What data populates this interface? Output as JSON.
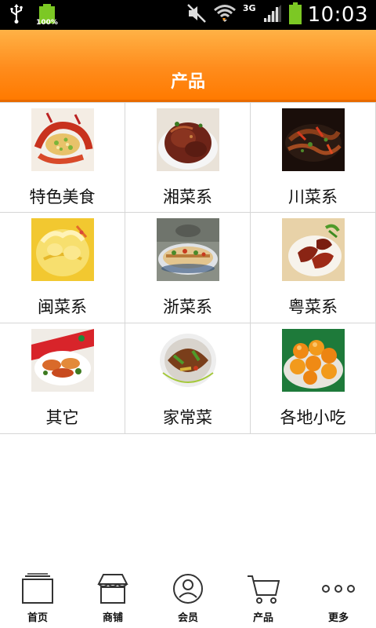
{
  "status_bar": {
    "battery_level_text": "100%",
    "network_type": "3G",
    "time": "10:03"
  },
  "header": {
    "title": "产品"
  },
  "categories": [
    {
      "label": "特色美食",
      "image": "food-photo-crayfish"
    },
    {
      "label": "湘菜系",
      "image": "food-photo-braised-pork"
    },
    {
      "label": "川菜系",
      "image": "food-photo-squid-stirfry"
    },
    {
      "label": "闽菜系",
      "image": "food-photo-white-chicken"
    },
    {
      "label": "浙菜系",
      "image": "food-photo-platter"
    },
    {
      "label": "粤菜系",
      "image": "food-photo-chicken-wings"
    },
    {
      "label": "其它",
      "image": "food-photo-assorted-plate"
    },
    {
      "label": "家常菜",
      "image": "food-photo-stirfry-bowl"
    },
    {
      "label": "各地小吃",
      "image": "food-photo-sesame-balls"
    }
  ],
  "bottom_nav": [
    {
      "label": "首页",
      "icon": "home-icon"
    },
    {
      "label": "商铺",
      "icon": "store-icon"
    },
    {
      "label": "会员",
      "icon": "member-icon"
    },
    {
      "label": "产品",
      "icon": "cart-icon"
    },
    {
      "label": "更多",
      "icon": "more-icon"
    }
  ],
  "colors": {
    "header_top": "#ffb246",
    "header_bottom": "#ff7a00",
    "status_bar": "#000000",
    "battery_green": "#7cc824",
    "divider": "#d6d6d6"
  }
}
